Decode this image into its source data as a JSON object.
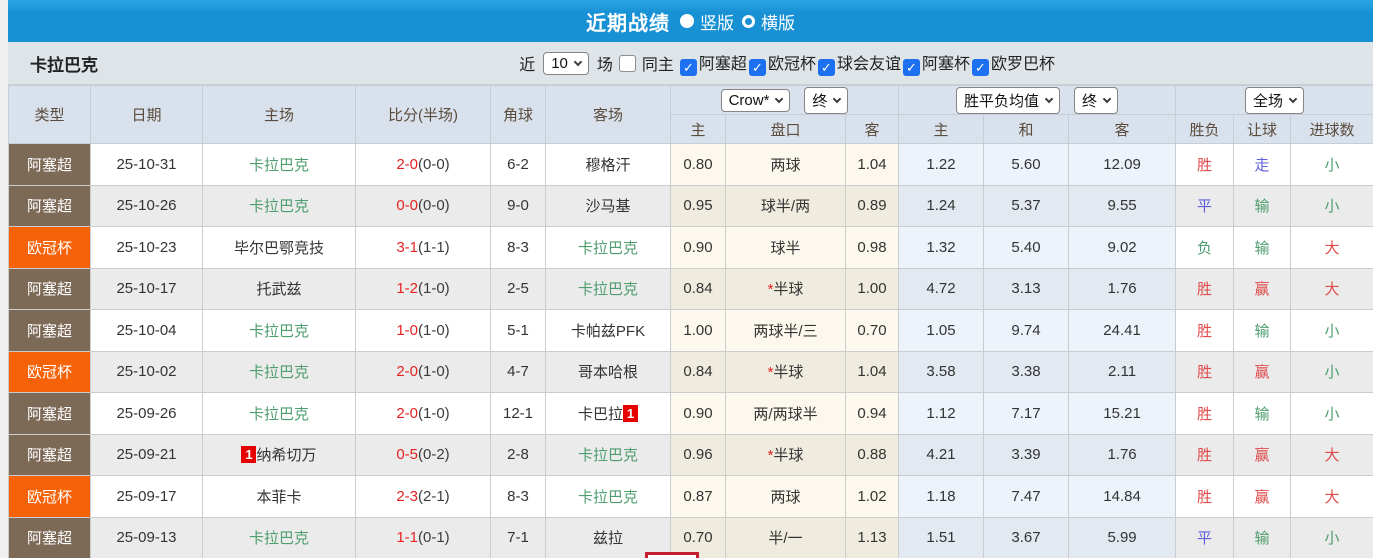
{
  "colors": {
    "title_bar": "#1791d4",
    "checkbox_blue": "#1d70f0",
    "team_green": "#4e9d6e",
    "score_red": "#e62222",
    "type_colors": {
      "阿塞超": "#7c6a57",
      "欧冠杯": "#f56207"
    },
    "outcome_colors": {
      "胜": "#e04b4b",
      "平": "#6060dd",
      "负": "#4e9d6e",
      "赢": "#e04b4b",
      "输": "#4e9d6e",
      "走": "#6060dd",
      "大": "#e04b4b",
      "小": "#4e9d6e"
    }
  },
  "title_bar": {
    "title": "近期战绩",
    "radios": [
      {
        "label": "竖版",
        "selected": true
      },
      {
        "label": "横版",
        "selected": false
      }
    ]
  },
  "filter_bar": {
    "team": "卡拉巴克",
    "recent_label": "近",
    "recent_value": "10",
    "games_label": "场",
    "same_home": {
      "label": "同主",
      "checked": false
    },
    "leagues": [
      {
        "label": "阿塞超",
        "checked": true
      },
      {
        "label": "欧冠杯",
        "checked": true
      },
      {
        "label": "球会友谊",
        "checked": true
      },
      {
        "label": "阿塞杯",
        "checked": true
      },
      {
        "label": "欧罗巴杯",
        "checked": true
      }
    ]
  },
  "table": {
    "main_headers": [
      "类型",
      "日期",
      "主场",
      "比分(半场)",
      "角球",
      "客场"
    ],
    "group_selects": {
      "odds_company": "Crow*",
      "odds_time": "终",
      "mean_type": "胜平负均值",
      "mean_time": "终",
      "scope": "全场"
    },
    "sub_headers": [
      "主",
      "盘口",
      "客",
      "主",
      "和",
      "客",
      "胜负",
      "让球",
      "进球数"
    ],
    "rows": [
      {
        "type": "阿塞超",
        "date": "25-10-31",
        "home": {
          "name": "卡拉巴克",
          "green": true
        },
        "score": "2-0",
        "half": "(0-0)",
        "corners": "6-2",
        "away": {
          "name": "穆格汗",
          "green": false
        },
        "odds_home": "0.80",
        "handicap": "两球",
        "odds_away": "1.04",
        "mean_home": "1.22",
        "mean_draw": "5.60",
        "mean_away": "12.09",
        "result": "胜",
        "handicap_result": "走",
        "goals": "小"
      },
      {
        "type": "阿塞超",
        "date": "25-10-26",
        "home": {
          "name": "卡拉巴克",
          "green": true
        },
        "score": "0-0",
        "half": "(0-0)",
        "corners": "9-0",
        "away": {
          "name": "沙马基",
          "green": false
        },
        "odds_home": "0.95",
        "handicap": "球半/两",
        "odds_away": "0.89",
        "mean_home": "1.24",
        "mean_draw": "5.37",
        "mean_away": "9.55",
        "result": "平",
        "handicap_result": "输",
        "goals": "小"
      },
      {
        "type": "欧冠杯",
        "date": "25-10-23",
        "home": {
          "name": "毕尔巴鄂竞技",
          "green": false
        },
        "score": "3-1",
        "half": "(1-1)",
        "corners": "8-3",
        "away": {
          "name": "卡拉巴克",
          "green": true
        },
        "odds_home": "0.90",
        "handicap": "球半",
        "odds_away": "0.98",
        "mean_home": "1.32",
        "mean_draw": "5.40",
        "mean_away": "9.02",
        "result": "负",
        "handicap_result": "输",
        "goals": "大"
      },
      {
        "type": "阿塞超",
        "date": "25-10-17",
        "home": {
          "name": "托武兹",
          "green": false
        },
        "score": "1-2",
        "half": "(1-0)",
        "corners": "2-5",
        "away": {
          "name": "卡拉巴克",
          "green": true
        },
        "odds_home": "0.84",
        "handicap": "*半球",
        "odds_away": "1.00",
        "mean_home": "4.72",
        "mean_draw": "3.13",
        "mean_away": "1.76",
        "result": "胜",
        "handicap_result": "赢",
        "goals": "大"
      },
      {
        "type": "阿塞超",
        "date": "25-10-04",
        "home": {
          "name": "卡拉巴克",
          "green": true
        },
        "score": "1-0",
        "half": "(1-0)",
        "corners": "5-1",
        "away": {
          "name": "卡帕兹PFK",
          "green": false
        },
        "odds_home": "1.00",
        "handicap": "两球半/三",
        "odds_away": "0.70",
        "mean_home": "1.05",
        "mean_draw": "9.74",
        "mean_away": "24.41",
        "result": "胜",
        "handicap_result": "输",
        "goals": "小"
      },
      {
        "type": "欧冠杯",
        "date": "25-10-02",
        "home": {
          "name": "卡拉巴克",
          "green": true
        },
        "score": "2-0",
        "half": "(1-0)",
        "corners": "4-7",
        "away": {
          "name": "哥本哈根",
          "green": false
        },
        "odds_home": "0.84",
        "handicap": "*半球",
        "odds_away": "1.04",
        "mean_home": "3.58",
        "mean_draw": "3.38",
        "mean_away": "2.11",
        "result": "胜",
        "handicap_result": "赢",
        "goals": "小"
      },
      {
        "type": "阿塞超",
        "date": "25-09-26",
        "home": {
          "name": "卡拉巴克",
          "green": true
        },
        "score": "2-0",
        "half": "(1-0)",
        "corners": "12-1",
        "away": {
          "name": "卡巴拉",
          "green": false,
          "badge": "1",
          "badge_pos": "after"
        },
        "odds_home": "0.90",
        "handicap": "两/两球半",
        "odds_away": "0.94",
        "mean_home": "1.12",
        "mean_draw": "7.17",
        "mean_away": "15.21",
        "result": "胜",
        "handicap_result": "输",
        "goals": "小"
      },
      {
        "type": "阿塞超",
        "date": "25-09-21",
        "home": {
          "name": "纳希切万",
          "green": false,
          "badge": "1",
          "badge_pos": "before"
        },
        "score": "0-5",
        "half": "(0-2)",
        "corners": "2-8",
        "away": {
          "name": "卡拉巴克",
          "green": true
        },
        "odds_home": "0.96",
        "handicap": "*半球",
        "odds_away": "0.88",
        "mean_home": "4.21",
        "mean_draw": "3.39",
        "mean_away": "1.76",
        "result": "胜",
        "handicap_result": "赢",
        "goals": "大"
      },
      {
        "type": "欧冠杯",
        "date": "25-09-17",
        "home": {
          "name": "本菲卡",
          "green": false
        },
        "score": "2-3",
        "half": "(2-1)",
        "corners": "8-3",
        "away": {
          "name": "卡拉巴克",
          "green": true
        },
        "odds_home": "0.87",
        "handicap": "两球",
        "odds_away": "1.02",
        "mean_home": "1.18",
        "mean_draw": "7.47",
        "mean_away": "14.84",
        "result": "胜",
        "handicap_result": "赢",
        "goals": "大"
      },
      {
        "type": "阿塞超",
        "date": "25-09-13",
        "home": {
          "name": "卡拉巴克",
          "green": true
        },
        "score": "1-1",
        "half": "(0-1)",
        "corners": "7-1",
        "away": {
          "name": "兹拉",
          "green": false
        },
        "odds_home": "0.70",
        "handicap": "半/一",
        "odds_away": "1.13",
        "mean_home": "1.51",
        "mean_draw": "3.67",
        "mean_away": "5.99",
        "result": "平",
        "handicap_result": "输",
        "goals": "小"
      }
    ]
  }
}
